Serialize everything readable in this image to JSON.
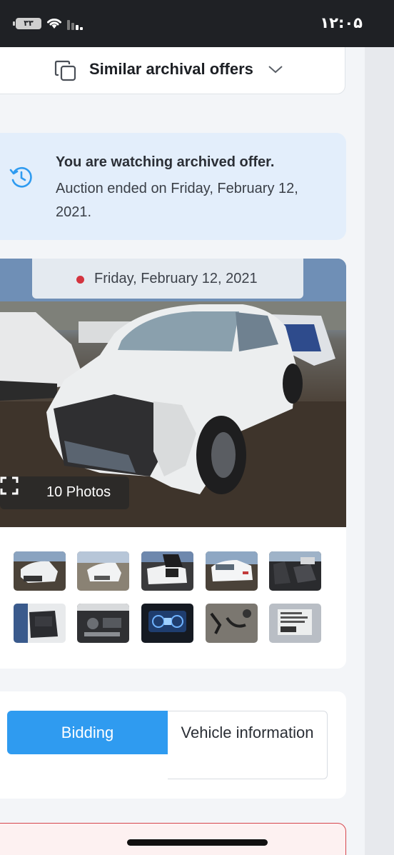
{
  "status_bar": {
    "time": "۱۲:۰۵",
    "battery": "۳۳"
  },
  "similar": {
    "label": "Similar archival offers"
  },
  "notice": {
    "title": "You are watching archived offer.",
    "subtitle": "Auction ended on Friday, February 12, 2021."
  },
  "gallery": {
    "date": "Friday, February 12, 2021",
    "photos_label": "10 Photos",
    "thumbnails": [
      {
        "name": "front-damage"
      },
      {
        "name": "front-view"
      },
      {
        "name": "rear-open"
      },
      {
        "name": "rear-view"
      },
      {
        "name": "front-seats"
      },
      {
        "name": "rear-seats"
      },
      {
        "name": "engine-bay"
      },
      {
        "name": "dashboard-cluster"
      },
      {
        "name": "parts"
      },
      {
        "name": "vin-label"
      }
    ]
  },
  "tabs": {
    "bidding": "Bidding",
    "vehicle_info": "Vehicle information"
  },
  "colors": {
    "accent": "#2f9bf0",
    "notice_bg": "#e3eefb",
    "alert": "#d6454d",
    "status_bar": "#1f2125"
  }
}
